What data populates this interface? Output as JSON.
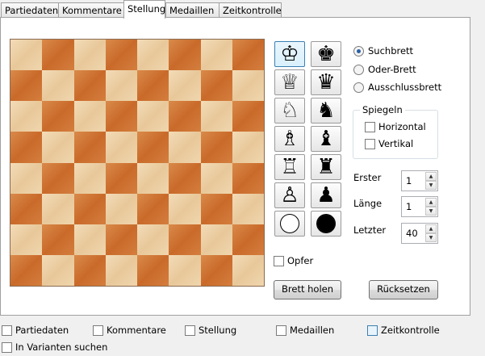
{
  "tabs": [
    "Partiedaten",
    "Kommentare",
    "Stellung",
    "Medaillen",
    "Zeitkontrolle"
  ],
  "active_tab": "Stellung",
  "pieces": {
    "white": [
      "♔",
      "♕",
      "♘",
      "♗",
      "♖",
      "♙"
    ],
    "black": [
      "♚",
      "♛",
      "♞",
      "♝",
      "♜",
      "♟"
    ]
  },
  "board_mode": {
    "options": [
      "Suchbrett",
      "Oder-Brett",
      "Ausschlussbrett"
    ],
    "selected": "Suchbrett"
  },
  "mirror": {
    "title": "Spiegeln",
    "horizontal": "Horizontal",
    "vertical": "Vertikal"
  },
  "fields": {
    "erster_label": "Erster",
    "erster_value": "1",
    "laenge_label": "Länge",
    "laenge_value": "1",
    "letzter_label": "Letzter",
    "letzter_value": "40"
  },
  "opfer_label": "Opfer",
  "buttons": {
    "brett_holen": "Brett holen",
    "ruecksetzen": "Rücksetzen"
  },
  "bottom_checks": [
    "Partiedaten",
    "Kommentare",
    "Stellung",
    "Medaillen",
    "Zeitkontrolle"
  ],
  "variants_label": "In Varianten suchen"
}
